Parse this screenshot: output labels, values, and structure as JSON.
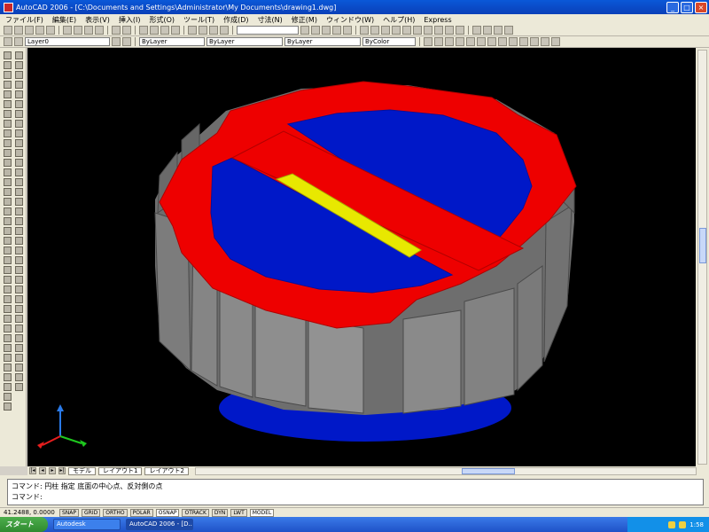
{
  "window": {
    "title": "AutoCAD 2006 - [C:\\Documents and Settings\\Administrator\\My Documents\\drawing1.dwg]",
    "buttons": [
      "_",
      "□",
      "×"
    ]
  },
  "menubar": [
    "ファイル(F)",
    "編集(E)",
    "表示(V)",
    "挿入(I)",
    "形式(O)",
    "ツール(T)",
    "作成(D)",
    "寸法(N)",
    "修正(M)",
    "ウィンドウ(W)",
    "ヘルプ(H)",
    "Express"
  ],
  "toolbar2": {
    "layer": "Layer0",
    "color": "ByLayer",
    "linetype": "ByLayer",
    "lineweight": "ByLayer",
    "plotstyle": "ByColor"
  },
  "model_tabs": {
    "model": "モデル",
    "layout1": "レイアウト1",
    "layout2": "レイアウト2"
  },
  "command": {
    "line1": "コマンド: 円柱 指定 底面の中心点、反対側の点",
    "line2": "コマンド:"
  },
  "status": {
    "coords": "41.2488, 0.0000",
    "buttons": [
      "SNAP",
      "GRID",
      "ORTHO",
      "POLAR",
      "OSNAP",
      "OTRACK",
      "DYN",
      "LWT",
      "MODEL"
    ]
  },
  "taskbar": {
    "start": "スタート",
    "tasks": [
      "Autodesk",
      "AutoCAD 2006 - [D..."
    ],
    "time": "1:58"
  },
  "colors": {
    "viewport_bg": "#000000",
    "top_red": "#ee0000",
    "cylinder_blue": "#0018c8",
    "bar_yellow": "#e8e800",
    "side_gray": "#707070"
  }
}
